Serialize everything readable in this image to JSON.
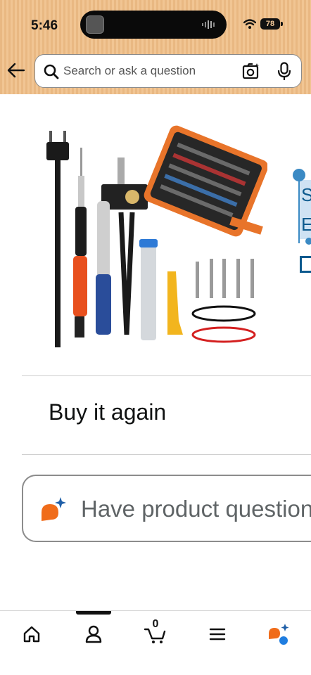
{
  "status_bar": {
    "time": "5:46",
    "battery": "78"
  },
  "search": {
    "placeholder": "Search or ask a question"
  },
  "selection_artifact": {
    "letters": [
      "S",
      "E"
    ]
  },
  "section": {
    "buy_again": "Buy it again"
  },
  "questions": {
    "text": "Have product questions?"
  },
  "bottom_nav": {
    "items": [
      {
        "name": "home",
        "icon": "home-icon"
      },
      {
        "name": "account",
        "icon": "person-icon",
        "active": true
      },
      {
        "name": "cart",
        "icon": "cart-icon",
        "count": "0"
      },
      {
        "name": "menu",
        "icon": "menu-icon"
      },
      {
        "name": "rufus",
        "icon": "rufus-icon"
      }
    ]
  },
  "colors": {
    "header_bg": "#f1c593",
    "rufus_orange": "#f06c1a",
    "rufus_blue": "#1f5fa8"
  }
}
